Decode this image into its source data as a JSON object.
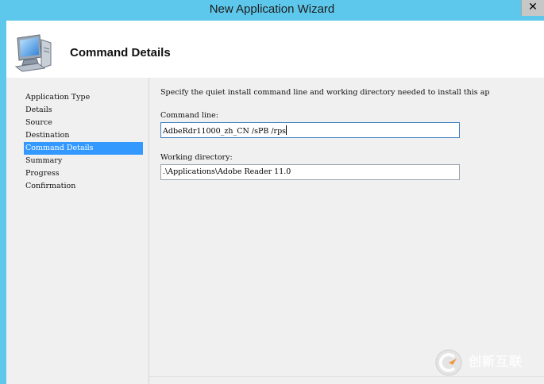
{
  "window": {
    "title": "New Application Wizard",
    "close_glyph": "✕"
  },
  "header": {
    "title": "Command Details",
    "icon": "computer-icon"
  },
  "sidebar": {
    "items": [
      {
        "label": "Application Type",
        "selected": false
      },
      {
        "label": "Details",
        "selected": false
      },
      {
        "label": "Source",
        "selected": false
      },
      {
        "label": "Destination",
        "selected": false
      },
      {
        "label": "Command Details",
        "selected": true
      },
      {
        "label": "Summary",
        "selected": false
      },
      {
        "label": "Progress",
        "selected": false
      },
      {
        "label": "Confirmation",
        "selected": false
      }
    ]
  },
  "main": {
    "instruction": "Specify the quiet install command line and working directory needed to install this ap",
    "command_line": {
      "label": "Command line:",
      "value": "AdbeRdr11000_zh_CN /sPB /rps"
    },
    "working_directory": {
      "label": "Working directory:",
      "value": ".\\Applications\\Adobe Reader 11.0"
    }
  },
  "watermark": {
    "text": "创新互联"
  },
  "colors": {
    "title_bar": "#5ec8ec",
    "selection": "#3399ff",
    "panel": "#f0f0f0"
  }
}
